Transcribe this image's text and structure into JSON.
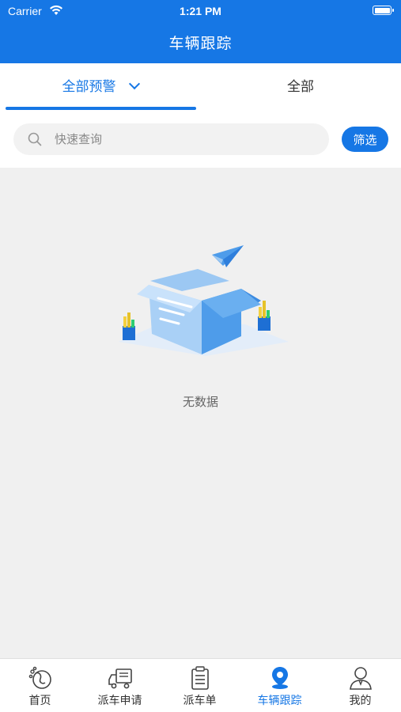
{
  "status_bar": {
    "carrier": "Carrier",
    "time": "1:21 PM"
  },
  "nav": {
    "title": "车辆跟踪"
  },
  "tabs": [
    {
      "label": "全部预警",
      "active": true
    },
    {
      "label": "全部",
      "active": false
    }
  ],
  "search": {
    "placeholder": "快速查询",
    "value": "",
    "filter_label": "筛选"
  },
  "empty": {
    "text": "无数据"
  },
  "tabbar": [
    {
      "label": "首页",
      "icon": "home-icon",
      "active": false
    },
    {
      "label": "派车申请",
      "icon": "truck-icon",
      "active": false
    },
    {
      "label": "派车单",
      "icon": "clipboard-icon",
      "active": false
    },
    {
      "label": "车辆跟踪",
      "icon": "location-pin-icon",
      "active": true
    },
    {
      "label": "我的",
      "icon": "user-icon",
      "active": false
    }
  ],
  "colors": {
    "primary": "#1677e5",
    "background": "#f0f0f0",
    "inactive_text": "#333333"
  }
}
